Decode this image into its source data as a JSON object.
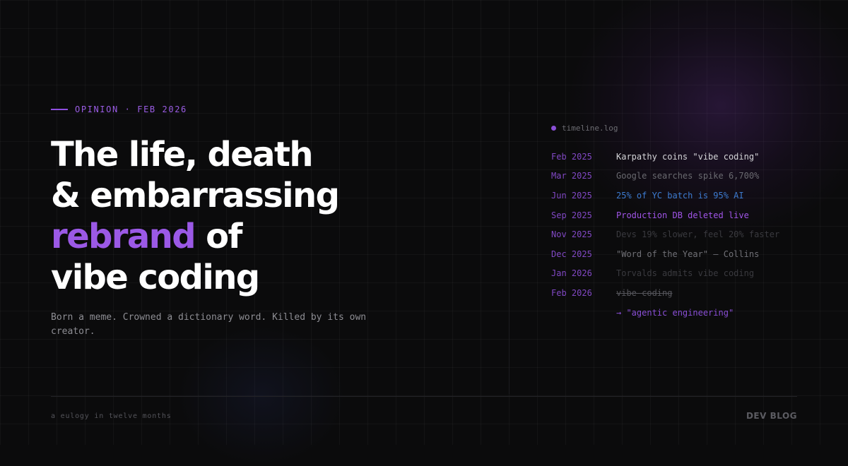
{
  "kicker": "OPINION · FEB 2026",
  "headline": {
    "line1": "The life, death",
    "line2": "& embarrassing",
    "line3_accent": "rebrand",
    "line3_rest": " of",
    "line4": "vibe coding"
  },
  "subtitle": "Born a meme. Crowned a dictionary word. Killed by its own creator.",
  "timeline": {
    "title": "timeline.log",
    "entries": [
      {
        "date": "Feb 2025",
        "event": "Karpathy coins \"vibe coding\""
      },
      {
        "date": "Mar 2025",
        "event": "Google searches spike 6,700%"
      },
      {
        "date": "Jun 2025",
        "event": "25% of YC batch is 95% AI"
      },
      {
        "date": "Sep 2025",
        "event": "Production DB deleted live"
      },
      {
        "date": "Nov 2025",
        "event": "Devs 19% slower, feel 20% faster"
      },
      {
        "date": "Dec 2025",
        "event": "\"Word of the Year\" — Collins"
      },
      {
        "date": "Jan 2026",
        "event": "Torvalds admits vibe coding"
      },
      {
        "date": "Feb 2026",
        "event": "vibe coding"
      },
      {
        "date": "",
        "event": "→ \"agentic engineering\""
      }
    ]
  },
  "footer": {
    "note": "a eulogy in twelve months",
    "brand": "DEV BLOG"
  },
  "colors": {
    "accent": "#9b59e6",
    "background": "#0b0b0c",
    "highlight_blue": "#3d7bd0"
  }
}
